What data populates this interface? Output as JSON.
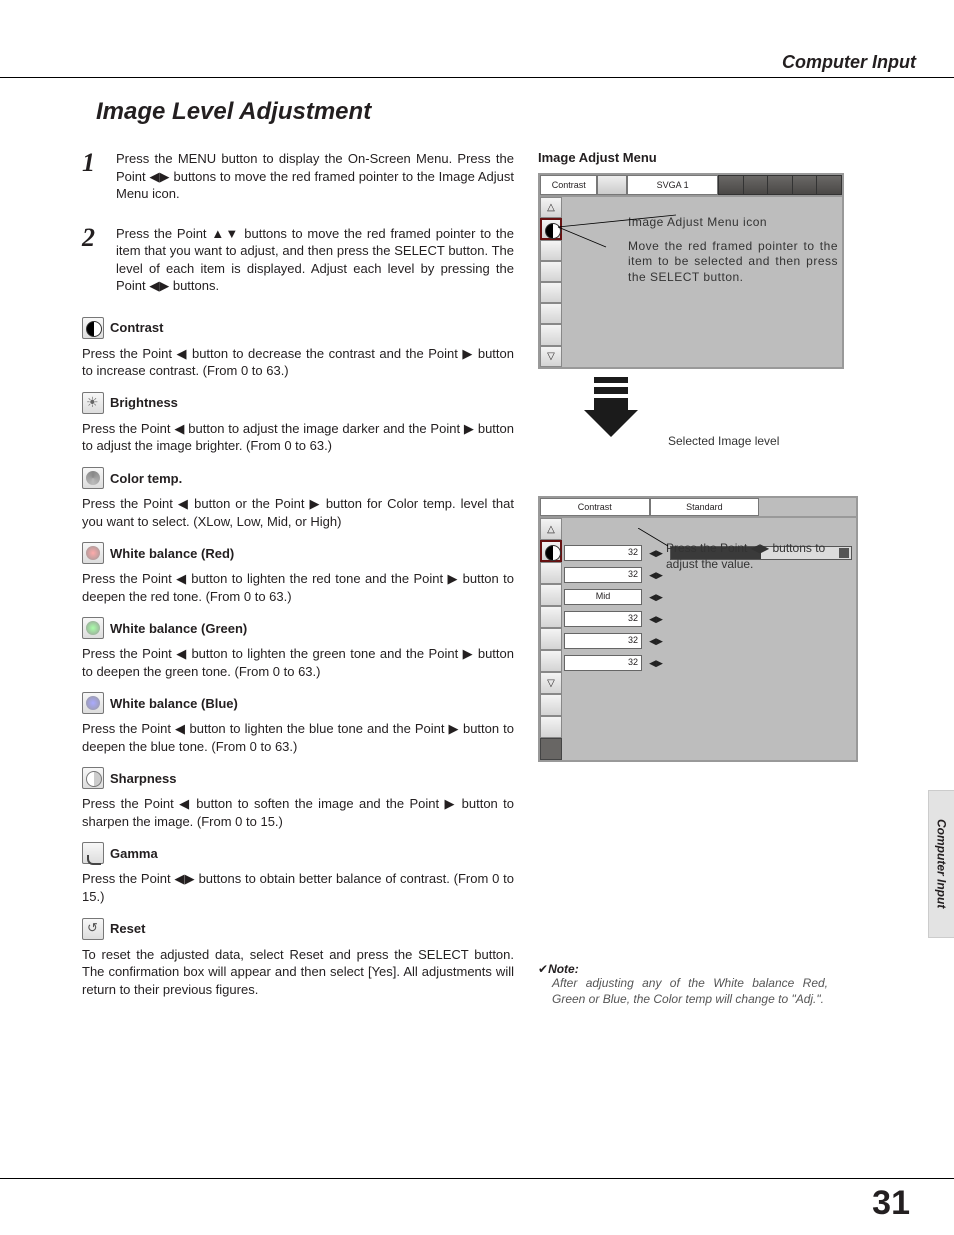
{
  "header": {
    "section": "Computer Input"
  },
  "title": "Image Level Adjustment",
  "steps": [
    {
      "num": "1",
      "body": "Press the MENU button to display the On-Screen Menu.  Press the Point ◀▶ buttons to move the red framed pointer to the Image Adjust Menu icon."
    },
    {
      "num": "2",
      "body": "Press the Point ▲▼ buttons to move the red framed pointer to the item that you want to adjust, and then press the SELECT button.  The level of each item is displayed.  Adjust each level by pressing the Point ◀▶ buttons."
    }
  ],
  "items": [
    {
      "key": "contrast",
      "icon": "contrast-icon",
      "title": "Contrast",
      "body": "Press the Point ◀ button to decrease the contrast and the Point ▶ button to increase contrast.  (From 0 to 63.)"
    },
    {
      "key": "brightness",
      "icon": "brightness-icon",
      "title": "Brightness",
      "body": "Press the Point ◀ button to adjust the image darker and the Point ▶ button to adjust the image brighter.  (From 0 to 63.)"
    },
    {
      "key": "colortemp",
      "icon": "color-temp-icon",
      "title": "Color temp.",
      "body": "Press the Point ◀ button or the Point ▶ button for Color temp. level that you want to select. (XLow, Low, Mid, or High)"
    },
    {
      "key": "wbred",
      "icon": "wb-red-icon",
      "title": "White balance (Red)",
      "body": "Press the Point ◀ button to lighten the red tone and the Point ▶ button to deepen the red tone.  (From 0 to 63.)"
    },
    {
      "key": "wbgreen",
      "icon": "wb-green-icon",
      "title": "White balance (Green)",
      "body": "Press the Point ◀ button to lighten the green tone and the Point ▶ button to deepen the green tone.  (From 0 to 63.)"
    },
    {
      "key": "wbblue",
      "icon": "wb-blue-icon",
      "title": "White balance (Blue)",
      "body": "Press the Point ◀ button to lighten the blue tone and the Point ▶ button to deepen the blue tone.  (From 0 to 63.)"
    },
    {
      "key": "sharpness",
      "icon": "sharpness-icon",
      "title": "Sharpness",
      "body": "Press the Point ◀ button to soften the image and the Point ▶ button to sharpen the image.  (From 0 to 15.)"
    },
    {
      "key": "gamma",
      "icon": "gamma-icon",
      "title": "Gamma",
      "body": "Press the Point ◀▶ buttons to obtain better balance of contrast.  (From 0 to 15.)"
    },
    {
      "key": "reset",
      "icon": "reset-icon",
      "title": "Reset",
      "body": "To reset the adjusted data, select Reset and press the SELECT button.  The confirmation box will appear and then select [Yes].  All adjustments will return to their previous figures."
    }
  ],
  "figure": {
    "heading": "Image Adjust Menu",
    "top_label": "Contrast",
    "top_mode": "SVGA 1",
    "callout_icon": "Image Adjust Menu icon",
    "callout_move": "Move the red framed pointer to the item to be selected and then press the SELECT button.",
    "selected_label": "Selected Image level",
    "second_title_left": "Contrast",
    "second_title_right": "Standard",
    "rows": [
      {
        "val": "32"
      },
      {
        "val": "32"
      },
      {
        "val": "Mid"
      },
      {
        "val": "32"
      },
      {
        "val": "32"
      },
      {
        "val": "32"
      }
    ],
    "adjust_callout": "Press the Point ◀▶ buttons to adjust the value."
  },
  "note": {
    "label": "Note:",
    "body": "After adjusting any of the White balance Red, Green or Blue, the Color temp will change to \"Adj.\"."
  },
  "side_tab": "Computer Input",
  "page_number": "31"
}
